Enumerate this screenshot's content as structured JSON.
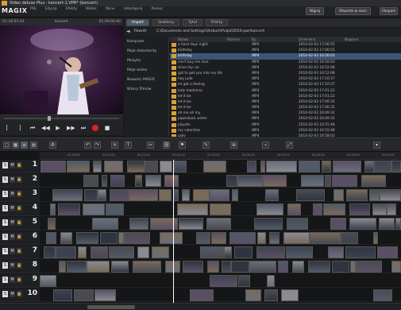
{
  "window": {
    "title": "Video deluxe Plus - koncert-1.VPR* (koncert)"
  },
  "menu": {
    "logo": "MAGIX",
    "items": [
      "Plik",
      "Edycja",
      "Efekty",
      "Widok",
      "Okno",
      "Udostępnij",
      "Pomoc"
    ]
  },
  "header_buttons": {
    "upload": "Wgraj",
    "online": "Otwarte w sieci",
    "export": "Eksport"
  },
  "monitor": {
    "source_label": "koncert",
    "timecode_left": "01:18:05.03",
    "timecode_right": "01:00:00.00"
  },
  "media_pool": {
    "tabs": [
      "Import",
      "Szablony",
      "Tytuł",
      "Efekty"
    ],
    "back_label": "Powrót",
    "path": "C:\\Documents and Settings\\Verbum\\Pulpit\\2010-pwr\\koncert",
    "tree": [
      "Komputer",
      "Moje dokumenty",
      "Muzyka",
      "Moje wideo",
      "Nowości MAGIX",
      "Wzory filmów"
    ],
    "columns": [
      "Nazwa",
      "Rozmiar",
      "Typ",
      "Zmieniono",
      "Nagrano"
    ],
    "files": [
      {
        "name": "a hard days night",
        "ext": ".MP4",
        "modified": "2010-02-03 17:06:55",
        "sel": false
      },
      {
        "name": "birthday",
        "ext": ".MP4",
        "modified": "2010-02-03 17:06:55",
        "sel": false
      },
      {
        "name": "birthday",
        "ext": ".MP4",
        "modified": "2010-02-03 16:56:03",
        "sel": true
      },
      {
        "name": "can't buy me love",
        "ext": ".MP4",
        "modified": "2010-02-03 16:56:03",
        "sel": false
      },
      {
        "name": "drive my car",
        "ext": ".MP4",
        "modified": "2010-02-03 16:52:08",
        "sel": false
      },
      {
        "name": "got to get you into my life",
        "ext": ".MP4",
        "modified": "2010-02-03 16:52:08",
        "sel": false
      },
      {
        "name": "hey jude",
        "ext": ".MP4",
        "modified": "2010-02-03 17:10:37",
        "sel": false
      },
      {
        "name": "im got a feeling",
        "ext": ".MP4",
        "modified": "2010-02-03 17:10:37",
        "sel": false
      },
      {
        "name": "lady madonna",
        "ext": ".MP4",
        "modified": "2010-02-03 17:01:22",
        "sel": false
      },
      {
        "name": "let it be",
        "ext": ".MP4",
        "modified": "2010-02-03 17:01:22",
        "sel": false
      },
      {
        "name": "let it be",
        "ext": ".MP4",
        "modified": "2010-02-03 17:06:35",
        "sel": false
      },
      {
        "name": "let it be",
        "ext": ".MP4",
        "modified": "2010-02-03 17:06:35",
        "sel": false
      },
      {
        "name": "oh me oh my",
        "ext": ".MP4",
        "modified": "2010-02-03 16:49:32",
        "sel": false
      },
      {
        "name": "paperback writer",
        "ext": ".MP4",
        "modified": "2010-02-03 16:49:32",
        "sel": false
      },
      {
        "name": "playdin",
        "ext": ".MP4",
        "modified": "2010-02-03 16:55:48",
        "sel": false
      },
      {
        "name": "my valentine",
        "ext": ".MP4",
        "modified": "2010-02-03 16:55:48",
        "sel": false
      },
      {
        "name": "sally",
        "ext": ".MP4",
        "modified": "2010-02-03 16:58:03",
        "sel": false
      },
      {
        "name": "something",
        "ext": ".MP4",
        "modified": "2010-02-03 16:58:03",
        "sel": false
      }
    ]
  },
  "timeline": {
    "track_numbers": [
      "1",
      "2",
      "3",
      "4",
      "5",
      "6",
      "7",
      "8",
      "9",
      "10"
    ],
    "ruler_marks": [
      "00:05:00",
      "00:10:00",
      "00:15:00",
      "00:20:00",
      "00:25:00",
      "00:30:00",
      "00:35:00",
      "00:40:00",
      "00:45:00",
      "00:50:00"
    ]
  }
}
